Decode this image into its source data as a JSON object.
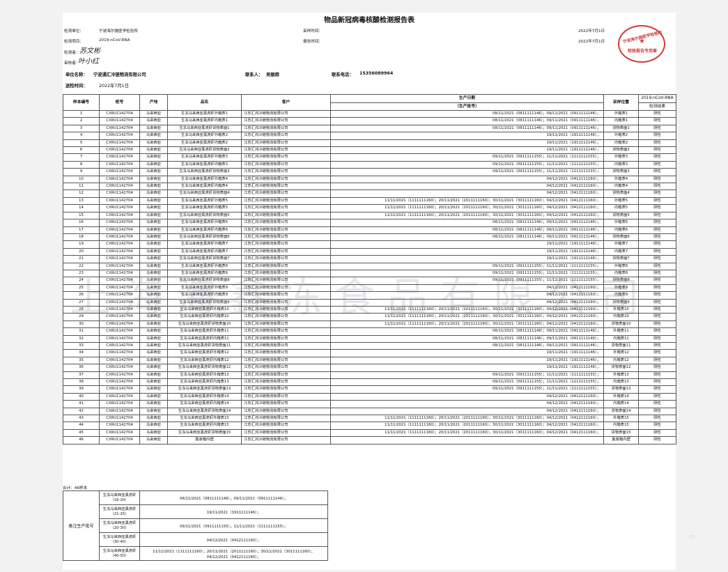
{
  "title": "物品新冠病毒核酸检测报告表",
  "header": {
    "unit_label": "检测单位：",
    "unit_value": "宁波海尔施医学检验所",
    "item_label": "检测项目：",
    "item_value": "2019-nCoV-RNA",
    "tester_label": "检测者：",
    "reviewer_label": "审核者：",
    "sample_time_label": "采样时间：",
    "sample_time_value": "2022年7月1日",
    "report_time_label": "报告时间：",
    "report_time_value": "2022年7月1日"
  },
  "stamp": {
    "line1": "宁波海尔施医学检验所",
    "line2": "检验报告专用章",
    "star": "★"
  },
  "signatures": {
    "tester": "苏文彬",
    "reviewer": "叶小红"
  },
  "info": {
    "company_label": "单位名称：",
    "company_value": "宁波通汇冷链物流有限公司",
    "contact_label": "联系人：",
    "contact_value": "吴丽群",
    "phone_label": "联系电话：",
    "phone_value": "15356089964",
    "send_label": "送检时间：",
    "send_value": "2022年7月1日"
  },
  "table": {
    "headers": {
      "no": "样本编号",
      "cabinet": "柜号",
      "origin": "产地",
      "name": "品名",
      "customer": "客户",
      "date": "生产日期",
      "date_sub": "（生产批号）",
      "position": "采样位置",
      "method": "2019-nCoV-RNA",
      "result": "检测结果"
    },
    "rows": [
      [
        "1",
        "CXRU1142704",
        "马来西亚",
        "生冻马来西亚黑虎虾外箱表1",
        "江苏汇鸿冷链物流有限公司",
        "08/11/2021（0811111146）；09/11/2021（0911111146）；",
        "外箱表1",
        "阴性"
      ],
      [
        "2",
        "CXRU1142704",
        "马来西亚",
        "生冻马来西亚黑虎虾内箱表1",
        "江苏汇鸿冷链物流有限公司",
        "08/11/2021（0811111146）；09/11/2021（0911111146）；",
        "内箱表1",
        "阴性"
      ],
      [
        "3",
        "CXRU1142704",
        "马来西亚",
        "生冻马来西亚黑虎虾货物表面1",
        "江苏汇鸿冷链物流有限公司",
        "08/11/2021（0811111146）；09/11/2021（0911111146）；",
        "货物表面1",
        "阴性"
      ],
      [
        "4",
        "CXRU1142704",
        "马来西亚",
        "生冻马来西亚黑虎虾外箱表2",
        "江苏汇鸿冷链物流有限公司",
        "19/11/2021（1911111146）；",
        "外箱表2",
        "阴性"
      ],
      [
        "5",
        "CXRU1142704",
        "马来西亚",
        "生冻马来西亚黑虎虾内箱表2",
        "江苏汇鸿冷链物流有限公司",
        "19/11/2021（1911111146）；",
        "内箱表2",
        "阴性"
      ],
      [
        "6",
        "CXRU1142704",
        "马来西亚",
        "生冻马来西亚黑虎虾货物表面2",
        "江苏汇鸿冷链物流有限公司",
        "19/11/2021（1911111146）；",
        "货物表面2",
        "阴性"
      ],
      [
        "7",
        "CXRU1142704",
        "马来西亚",
        "生冻马来西亚黑虎虾外箱表3",
        "江苏汇鸿冷链物流有限公司",
        "09/11/2021（0911111155）；11/11/2021（1111111155）；",
        "外箱表3",
        "阴性"
      ],
      [
        "8",
        "CXRU1142704",
        "马来西亚",
        "生冻马来西亚黑虎虾内箱表3",
        "江苏汇鸿冷链物流有限公司",
        "09/11/2021（0911111155）；11/11/2021（1111111155）；",
        "内箱表3",
        "阴性"
      ],
      [
        "9",
        "CXRU1142704",
        "马来西亚",
        "生冻马来西亚黑虎虾货物表面3",
        "江苏汇鸿冷链物流有限公司",
        "09/11/2021（0911111155）；11/11/2021（1111111155）；",
        "货物表面3",
        "阴性"
      ],
      [
        "10",
        "CXRU1142704",
        "马来西亚",
        "生冻马来西亚黑虎虾外箱表4",
        "江苏汇鸿冷链物流有限公司",
        "04/12/2021（0412111160）；",
        "外箱表4",
        "阴性"
      ],
      [
        "11",
        "CXRU1142704",
        "马来西亚",
        "生冻马来西亚黑虎虾内箱表4",
        "江苏汇鸿冷链物流有限公司",
        "04/12/2021（0412111160）；",
        "内箱表4",
        "阴性"
      ],
      [
        "12",
        "CXRU1142704",
        "马来西亚",
        "生冻马来西亚黑虎虾货物表面4",
        "江苏汇鸿冷链物流有限公司",
        "04/12/2021（0412111160）；",
        "货物表面4",
        "阴性"
      ],
      [
        "13",
        "CXRU1142704",
        "马来西亚",
        "生冻马来西亚黑虎虾外箱表5",
        "江苏汇鸿冷链物流有限公司",
        "11/11/2021（1111111160）；20/11/2021（2011111160）；30/11/2021（3011111160）；04/12/2021（0412111160）；",
        "外箱表5",
        "阴性"
      ],
      [
        "14",
        "CXRU1142704",
        "马来西亚",
        "生冻马来西亚黑虎虾内箱表5",
        "江苏汇鸿冷链物流有限公司",
        "11/11/2021（1111111160）；20/11/2021（2011111160）；30/11/2021（3011111160）；04/12/2021（0412111160）；",
        "内箱表5",
        "阴性"
      ],
      [
        "15",
        "CXRU1142704",
        "马来西亚",
        "生冻马来西亚黑虎虾货物表面5",
        "江苏汇鸿冷链物流有限公司",
        "11/11/2021（1111111160）；20/11/2021（2011111160）；30/11/2021（3011111160）；04/12/2021（0412111160）；",
        "货物表面5",
        "阴性"
      ],
      [
        "16",
        "CXRU1142704",
        "马来西亚",
        "生冻马来西亚黑虎虾外箱表6",
        "江苏汇鸿冷链物流有限公司",
        "08/11/2021（0811111146）；09/11/2021（0911111146）；",
        "外箱表6",
        "阴性"
      ],
      [
        "17",
        "CXRU1142704",
        "马来西亚",
        "生冻马来西亚黑虎虾内箱表6",
        "江苏汇鸿冷链物流有限公司",
        "08/11/2021（0811111146）；09/11/2021（0911111146）；",
        "内箱表6",
        "阴性"
      ],
      [
        "18",
        "CXRU1142704",
        "马来西亚",
        "生冻马来西亚黑虎虾货物表面6",
        "江苏汇鸿冷链物流有限公司",
        "08/11/2021（0811111146）；09/11/2021（0911111146）；",
        "货物表面6",
        "阴性"
      ],
      [
        "19",
        "CXRU1142704",
        "马来西亚",
        "生冻马来西亚黑虎虾外箱表7",
        "江苏汇鸿冷链物流有限公司",
        "19/11/2021（1911111146）；",
        "外箱表7",
        "阴性"
      ],
      [
        "20",
        "CXRU1142704",
        "马来西亚",
        "生冻马来西亚黑虎虾内箱表7",
        "江苏汇鸿冷链物流有限公司",
        "19/11/2021（1911111146）；",
        "内箱表7",
        "阴性"
      ],
      [
        "21",
        "CXRU1142704",
        "马来西亚",
        "生冻马来西亚黑虎虾货物表面7",
        "江苏汇鸿冷链物流有限公司",
        "19/11/2021（1911111146）；",
        "货物表面7",
        "阴性"
      ],
      [
        "22",
        "CXRU1142704",
        "马来西亚",
        "生冻马来西亚黑虎虾外箱表8",
        "江苏汇鸿冷链物流有限公司",
        "09/11/2021（0911111155）；11/11/2021（1111111155）；",
        "外箱表8",
        "阴性"
      ],
      [
        "23",
        "CXRU1142704",
        "马来西亚",
        "生冻马来西亚黑虎虾内箱表8",
        "江苏汇鸿冷链物流有限公司",
        "09/11/2021（0911111155）；11/11/2021（1111111155）；",
        "内箱表8",
        "阴性"
      ],
      [
        "24",
        "CXRU1142704",
        "马来西亚",
        "生冻马来西亚黑虎虾货物表面8",
        "江苏汇鸿冷链物流有限公司",
        "09/11/2021（0911111155）；11/11/2021（1111111155）；",
        "货物表面8",
        "阴性"
      ],
      [
        "25",
        "CXRU1142704",
        "马来西亚",
        "生冻马来西亚黑虎虾外箱表9",
        "江苏汇鸿冷链物流有限公司",
        "04/12/2021（0412111160）；",
        "外箱表9",
        "阴性"
      ],
      [
        "26",
        "CXRU1142704",
        "马来西亚",
        "生冻马来西亚黑虎虾内箱表9",
        "江苏汇鸿冷链物流有限公司",
        "04/12/2021（0412111160）；",
        "内箱表9",
        "阴性"
      ],
      [
        "27",
        "CXRU1142704",
        "马来西亚",
        "生冻马来西亚黑虎虾货物表面9",
        "江苏汇鸿冷链物流有限公司",
        "04/12/2021（0412111160）；",
        "货物表面9",
        "阴性"
      ],
      [
        "28",
        "CXRU1142704",
        "马来西亚",
        "生冻马来西亚黑虎虾外箱表10",
        "江苏汇鸿冷链物流有限公司",
        "11/11/2021（1111111160）；20/11/2021（2011111160）；30/11/2021（3011111160）；04/12/2021（0412111160）；",
        "外箱表10",
        "阴性"
      ],
      [
        "29",
        "CXRU1142704",
        "马来西亚",
        "生冻马来西亚黑虎虾内箱表10",
        "江苏汇鸿冷链物流有限公司",
        "11/11/2021（1111111160）；20/11/2021（2011111160）；30/11/2021（3011111160）；04/12/2021（0412111160）；",
        "内箱表10",
        "阴性"
      ],
      [
        "30",
        "CXRU1142704",
        "马来西亚",
        "生冻马来西亚黑虎虾货物表面10",
        "江苏汇鸿冷链物流有限公司",
        "11/11/2021（1111111160）；20/11/2021（2011111160）；30/11/2021（3011111160）；04/12/2021（0412111160）；",
        "货物表面10",
        "阴性"
      ],
      [
        "31",
        "CXRU1142704",
        "马来西亚",
        "生冻马来西亚黑虎虾外箱表11",
        "江苏汇鸿冷链物流有限公司",
        "08/11/2021（0811111146）；09/11/2021（0911111146）；",
        "外箱表11",
        "阴性"
      ],
      [
        "32",
        "CXRU1142704",
        "马来西亚",
        "生冻马来西亚黑虎虾内箱表11",
        "江苏汇鸿冷链物流有限公司",
        "08/11/2021（0811111146）；09/11/2021（0911111146）；",
        "内箱表11",
        "阴性"
      ],
      [
        "33",
        "CXRU1142704",
        "马来西亚",
        "生冻马来西亚黑虎虾货物表面11",
        "江苏汇鸿冷链物流有限公司",
        "08/11/2021（0811111146）；09/11/2021（0911111146）；",
        "货物表面11",
        "阴性"
      ],
      [
        "34",
        "CXRU1142704",
        "马来西亚",
        "生冻马来西亚黑虎虾外箱表12",
        "江苏汇鸿冷链物流有限公司",
        "19/11/2021（1911111146）；",
        "外箱表12",
        "阴性"
      ],
      [
        "35",
        "CXRU1142704",
        "马来西亚",
        "生冻马来西亚黑虎虾内箱表12",
        "江苏汇鸿冷链物流有限公司",
        "19/11/2021（1911111146）；",
        "内箱表12",
        "阴性"
      ],
      [
        "36",
        "CXRU1142704",
        "马来西亚",
        "生冻马来西亚黑虎虾货物表面12",
        "江苏汇鸿冷链物流有限公司",
        "19/11/2021（1911111146）；",
        "货物表面12",
        "阴性"
      ],
      [
        "37",
        "CXRU1142704",
        "马来西亚",
        "生冻马来西亚黑虎虾外箱表13",
        "江苏汇鸿冷链物流有限公司",
        "09/11/2021（0911111155）；11/11/2021（1111111155）；",
        "外箱表13",
        "阴性"
      ],
      [
        "38",
        "CXRU1142704",
        "马来西亚",
        "生冻马来西亚黑虎虾内箱表13",
        "江苏汇鸿冷链物流有限公司",
        "09/11/2021（0911111155）；11/11/2021（1111111155）；",
        "内箱表13",
        "阴性"
      ],
      [
        "39",
        "CXRU1142704",
        "马来西亚",
        "生冻马来西亚黑虎虾货物表面13",
        "江苏汇鸿冷链物流有限公司",
        "09/11/2021（0911111155）；11/11/2021（1111111155）；",
        "货物表面13",
        "阴性"
      ],
      [
        "40",
        "CXRU1142704",
        "马来西亚",
        "生冻马来西亚黑虎虾外箱表14",
        "江苏汇鸿冷链物流有限公司",
        "04/12/2021（0412111160）；",
        "外箱表14",
        "阴性"
      ],
      [
        "41",
        "CXRU1142704",
        "马来西亚",
        "生冻马来西亚黑虎虾内箱表14",
        "江苏汇鸿冷链物流有限公司",
        "04/12/2021（0412111160）；",
        "内箱表14",
        "阴性"
      ],
      [
        "42",
        "CXRU1142704",
        "马来西亚",
        "生冻马来西亚黑虎虾货物表面14",
        "江苏汇鸿冷链物流有限公司",
        "04/12/2021（0412111160）；",
        "货物表面14",
        "阴性"
      ],
      [
        "43",
        "CXRU1142704",
        "马来西亚",
        "生冻马来西亚黑虎虾外箱表15",
        "江苏汇鸿冷链物流有限公司",
        "11/11/2021（1111111160）；20/11/2021（2011111160）；30/11/2021（3011111160）；04/12/2021（0412111160）；",
        "外箱表15",
        "阴性"
      ],
      [
        "44",
        "CXRU1142704",
        "马来西亚",
        "生冻马来西亚黑虎虾内箱表15",
        "江苏汇鸿冷链物流有限公司",
        "11/11/2021（1111111160）；20/11/2021（2011111160）；30/11/2021（3011111160）；04/12/2021（0412111160）；",
        "内箱表15",
        "阴性"
      ],
      [
        "45",
        "CXRU1142704",
        "马来西亚",
        "生冻马来西亚黑虎虾货物表面15",
        "江苏汇鸿冷链物流有限公司",
        "11/11/2021（1111111160）；20/11/2021（2011111160）；30/11/2021（3011111160）；04/12/2021（0412111160）；",
        "货物表面15",
        "阴性"
      ],
      [
        "46",
        "CXRU1142704",
        "马来西亚",
        "集装箱内壁",
        "江苏汇鸿冷链物流有限公司",
        "",
        "集装箱内壁",
        "阴性"
      ]
    ]
  },
  "total": "合计：46样本",
  "notes": {
    "label": "备注生产批号",
    "rows": [
      {
        "name": "生冻马来西亚黑虎虾",
        "range": "（16-20）",
        "batch": "08/11/2021（0811111146）；09/11/2021（0911111146）；"
      },
      {
        "name": "生冻马来西亚黑虎虾",
        "range": "（21-25）",
        "batch": "19/11/2021（1911111146）；"
      },
      {
        "name": "生冻马来西亚黑虎虾",
        "range": "（20-30）",
        "batch": "09/11/2021（0911111155）；11/11/2021（1111111155）；"
      },
      {
        "name": "生冻马来西亚黑虎虾",
        "range": "（30-40）",
        "batch": "04/12/2021（0412111160）；"
      },
      {
        "name": "生冻马来西亚黑虎虾",
        "range": "（40-50）",
        "batch": "11/11/2021（1111111160）；20/11/2021（2011111160）；30/11/2021（3011111160）；",
        "batch2": "04/12/2021（0412111160）；"
      }
    ]
  },
  "watermark": "上海海鑫冻食品有限公司",
  "corner_mark": "m"
}
